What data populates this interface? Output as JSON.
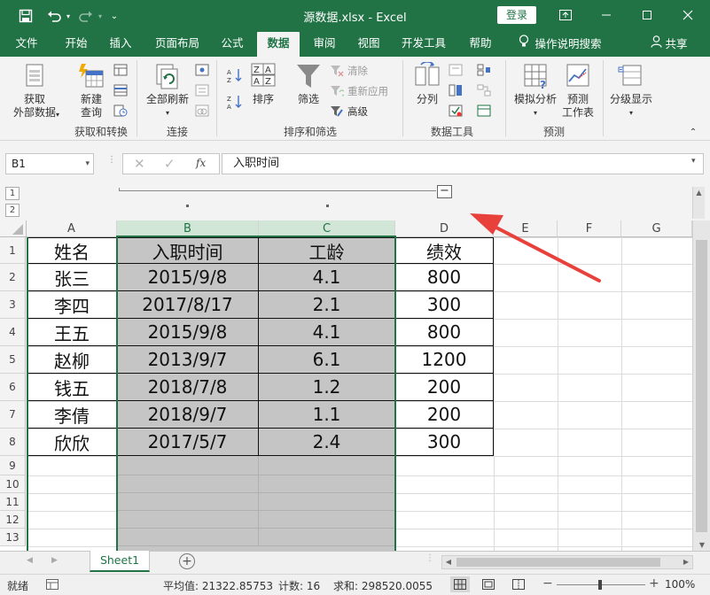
{
  "window": {
    "title": "源数据.xlsx  -  Excel",
    "login_label": "登录"
  },
  "tabs": [
    "文件",
    "开始",
    "插入",
    "页面布局",
    "公式",
    "数据",
    "审阅",
    "视图",
    "开发工具",
    "帮助"
  ],
  "active_tab": "数据",
  "tell_me": "操作说明搜索",
  "share": "共享",
  "ribbon": {
    "get_external": "获取\n外部数据",
    "new_query": "新建\n查询",
    "refresh_all": "全部刷新",
    "sort": "排序",
    "filter": "筛选",
    "clear": "清除",
    "reapply": "重新应用",
    "advanced": "高级",
    "text_to_columns": "分列",
    "what_if": "模拟分析",
    "forecast_sheet": "预测\n工作表",
    "outline": "分级显示",
    "groups": {
      "get_transform": "获取和转换",
      "connections": "连接",
      "sort_filter": "排序和筛选",
      "data_tools": "数据工具",
      "forecast": "预测"
    }
  },
  "formula_bar": {
    "name_box": "B1",
    "fx": "fx",
    "content": "入职时间"
  },
  "outline_levels": [
    "1",
    "2"
  ],
  "columns": [
    "A",
    "B",
    "C",
    "D",
    "E",
    "F",
    "G"
  ],
  "rows": [
    "1",
    "2",
    "3",
    "4",
    "5",
    "6",
    "7",
    "8",
    "9",
    "10",
    "11",
    "12",
    "13"
  ],
  "table": {
    "header": [
      "姓名",
      "入职时间",
      "工龄",
      "绩效"
    ],
    "rows": [
      [
        "张三",
        "2015/9/8",
        "4.1",
        "800"
      ],
      [
        "李四",
        "2017/8/17",
        "2.1",
        "300"
      ],
      [
        "王五",
        "2015/9/8",
        "4.1",
        "800"
      ],
      [
        "赵柳",
        "2013/9/7",
        "6.1",
        "1200"
      ],
      [
        "钱五",
        "2018/7/8",
        "1.2",
        "200"
      ],
      [
        "李倩",
        "2018/9/7",
        "1.1",
        "200"
      ],
      [
        "欣欣",
        "2017/5/7",
        "2.4",
        "300"
      ]
    ]
  },
  "sheets": [
    "Sheet1"
  ],
  "status": {
    "ready": "就绪",
    "average": "平均值: 21322.85753",
    "count": "计数: 16",
    "sum": "求和: 298520.0055",
    "zoom": "100%"
  },
  "colors": {
    "excel_green": "#217346",
    "selected_fill": "#c5c5c5",
    "arrow": "#e8413c"
  }
}
